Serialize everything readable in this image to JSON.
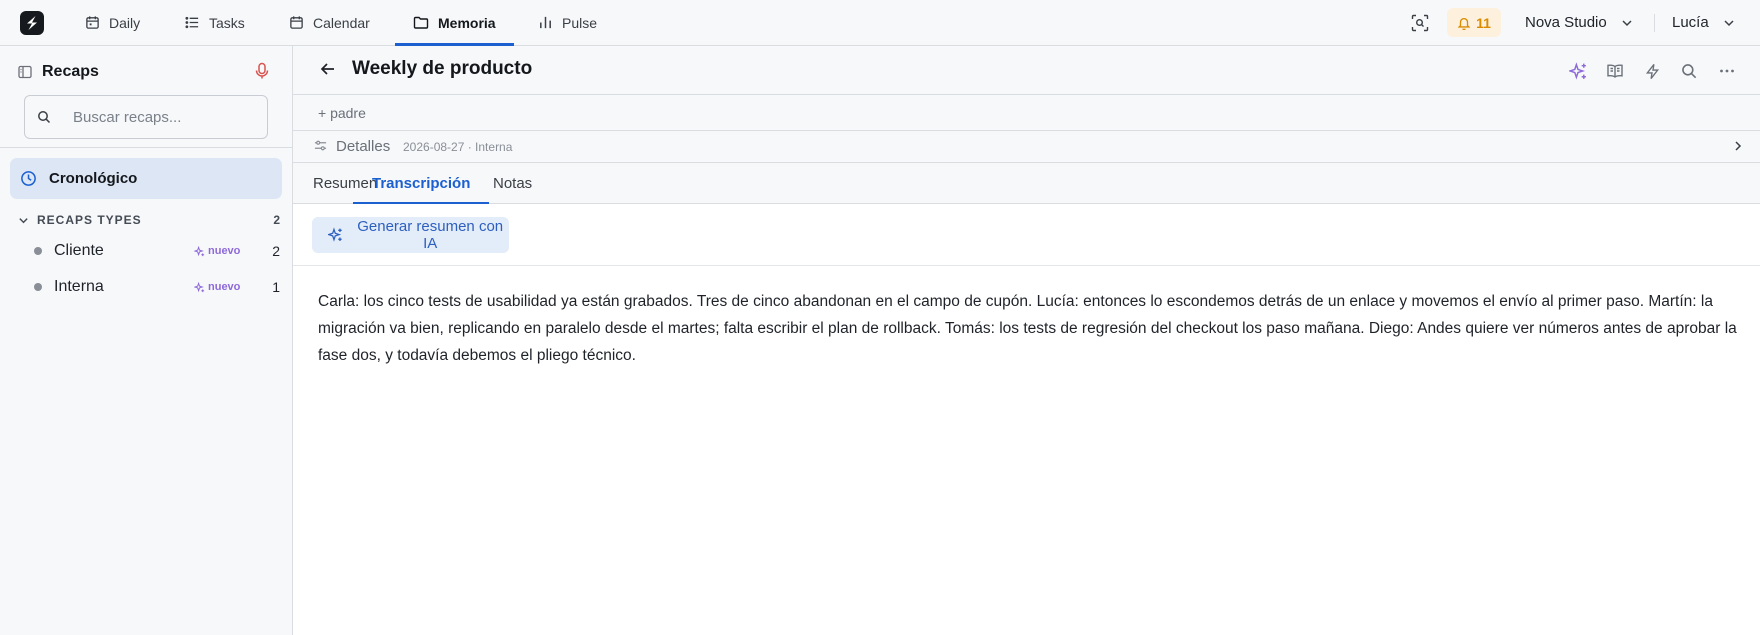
{
  "nav": {
    "items": [
      {
        "label": "Daily",
        "icon": "calendar-day-icon"
      },
      {
        "label": "Tasks",
        "icon": "list-icon"
      },
      {
        "label": "Calendar",
        "icon": "calendar-icon"
      },
      {
        "label": "Memoria",
        "icon": "folder-icon",
        "active": true
      },
      {
        "label": "Pulse",
        "icon": "bar-chart-icon"
      }
    ],
    "notifications": "11",
    "workspace": "Nova Studio",
    "user": "Lucía"
  },
  "sidebar": {
    "title": "Recaps",
    "search_placeholder": "Buscar recaps...",
    "selected": "Cronológico",
    "types_header": "RECAPS TYPES",
    "types_count": "2",
    "types": [
      {
        "label": "Cliente",
        "badge": "nuevo",
        "count": "2"
      },
      {
        "label": "Interna",
        "badge": "nuevo",
        "count": "1"
      }
    ]
  },
  "doc": {
    "title": "Weekly de producto",
    "parent_link": "+ padre",
    "details_label": "Detalles",
    "details_meta": "2026-08-27 · Interna",
    "tabs": [
      "Resumen",
      "Transcripción",
      "Notas"
    ],
    "active_tab": "Transcripción",
    "ai_button": "Generar resumen con IA",
    "transcript": "Carla: los cinco tests de usabilidad ya están grabados. Tres de cinco abandonan en el campo de cupón. Lucía: entonces lo escondemos detrás de un enlace y movemos el envío al primer paso. Martín: la migración va bien, replicando en paralelo desde el martes; falta escribir el plan de rollback. Tomás: los tests de regresión del checkout los paso mañana. Diego: Andes quiere ver números antes de aprobar la fase dos, y todavía debemos el pliego técnico."
  },
  "colors": {
    "accent": "#1b5fd1",
    "notif_bg": "#fdf1dd",
    "notif_fg": "#d98b00",
    "badge": "#8e6ad9",
    "mic": "#d9534f"
  }
}
